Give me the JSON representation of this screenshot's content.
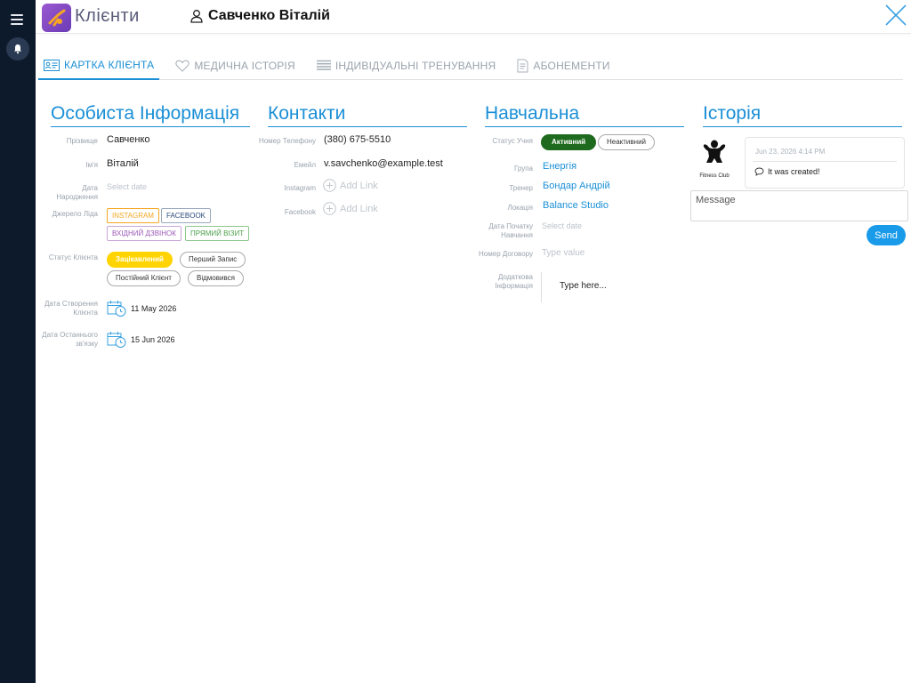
{
  "app": {
    "title": "Клієнти"
  },
  "client": {
    "name": "Савченко Віталій"
  },
  "tabs": [
    {
      "label": "КАРТКА КЛІЄНТА",
      "icon": "id-card-icon",
      "active": true
    },
    {
      "label": "МЕДИЧНА ІСТОРІЯ",
      "icon": "heart-icon"
    },
    {
      "label": "ІНДИВІДУАЛЬНІ ТРЕНУВАННЯ",
      "icon": "list-icon"
    },
    {
      "label": "АБОНЕМЕНТИ",
      "icon": "document-icon"
    }
  ],
  "personal": {
    "title": "Особиста Інформація",
    "surname_label": "Прізвище",
    "surname": "Савченко",
    "name_label": "Ім'я",
    "name": "Віталій",
    "birth_label": "Дата Народження",
    "birth_placeholder": "Select date",
    "source_label": "Джерело Ліда",
    "sources": [
      "INSTAGRAM",
      "FACEBOOK",
      "ВХІДНИЙ ДЗВІНОК",
      "ПРЯМИЙ ВІЗИТ"
    ],
    "status_label": "Статус Клієнта",
    "statuses": [
      "Зацікавлений",
      "Перший Запис",
      "Постійний Клієнт",
      "Відмовився"
    ],
    "created_label": "Дата Створення Клієнта",
    "created": "11 May 2026",
    "last_contact_label": "Дата Останнього зв'язку",
    "last_contact": "15 Jun 2026"
  },
  "contacts": {
    "title": "Контакти",
    "phone_label": "Номер Телефону",
    "phone": "(380) 675-5510",
    "email_label": "Емейл",
    "email": "v.savchenko@example.test",
    "instagram_label": "Instagram",
    "facebook_label": "Facebook",
    "add_link": "Add Link"
  },
  "study": {
    "title": "Навчальна",
    "status_label": "Статус Учня",
    "active": "Активний",
    "inactive": "Неактивний",
    "group_label": "Група",
    "group": "Енергія",
    "trainer_label": "Тренер",
    "trainer": "Бондар Андрій",
    "location_label": "Локація",
    "location": "Balance Studio",
    "start_label": "Дата Початку Навчання",
    "start_placeholder": "Select date",
    "contract_label": "Номер Договору",
    "contract_placeholder": "Type value",
    "extra_label": "Додаткова Інформація",
    "extra_placeholder": "Type here..."
  },
  "history": {
    "title": "Історія",
    "avatar_caption": "Fitness Club",
    "timestamp": "Jun 23, 2026 4:14 PM",
    "entry": "It was created!",
    "message_placeholder": "Message",
    "send": "Send"
  },
  "colors": {
    "accent": "#1a8fd6",
    "sidebar": "#0d1a2b",
    "active_status": "#1e6a1e",
    "interested": "#ffd400"
  }
}
